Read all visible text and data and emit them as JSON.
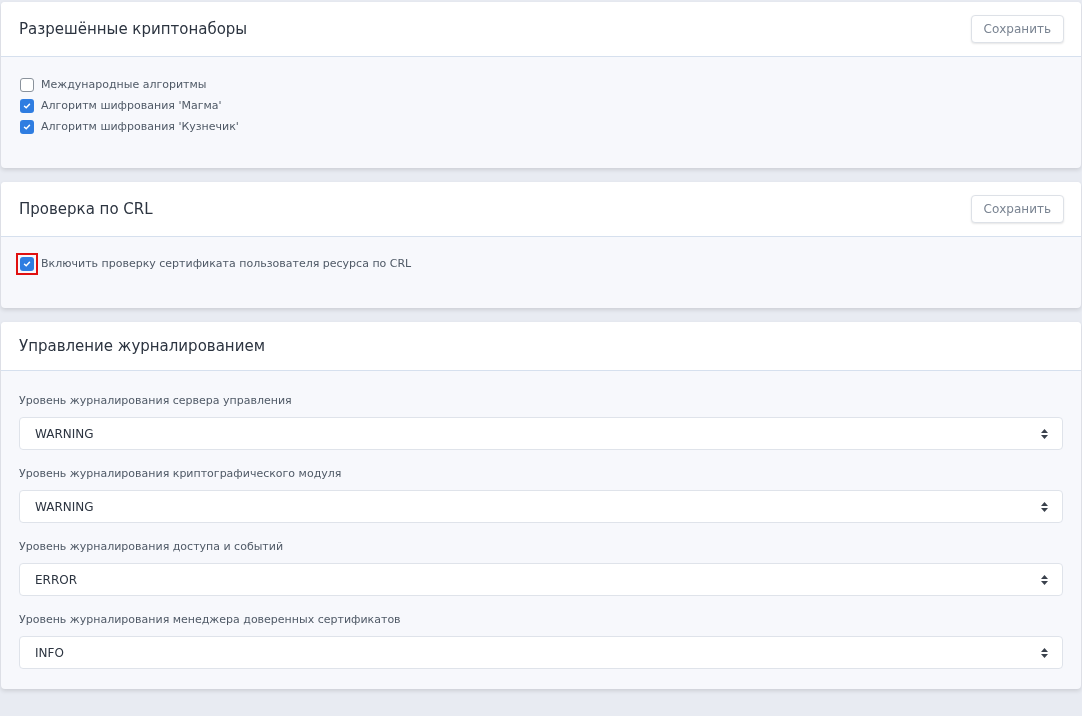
{
  "cards": [
    {
      "kind": "checkboxes",
      "title": "Разрешённые криптонаборы",
      "save_button": "Сохранить",
      "items": [
        {
          "label": "Международные алгоритмы",
          "checked": false,
          "highlighted": false
        },
        {
          "label": "Алгоритм шифрования 'Магма'",
          "checked": true,
          "highlighted": false
        },
        {
          "label": "Алгоритм шифрования 'Кузнечик'",
          "checked": true,
          "highlighted": false
        }
      ]
    },
    {
      "kind": "checkboxes",
      "title": "Проверка по CRL",
      "save_button": "Сохранить",
      "items": [
        {
          "label": "Включить проверку сертификата пользователя ресурса по CRL",
          "checked": true,
          "highlighted": true
        }
      ]
    },
    {
      "kind": "selects",
      "title": "Управление журналированием",
      "fields": [
        {
          "label": "Уровень журналирования сервера управления",
          "value": "WARNING"
        },
        {
          "label": "Уровень журналирования криптографического модуля",
          "value": "WARNING"
        },
        {
          "label": "Уровень журналирования доступа и событий",
          "value": "ERROR"
        },
        {
          "label": "Уровень журналирования менеджера доверенных сертификатов",
          "value": "INFO"
        }
      ]
    }
  ]
}
